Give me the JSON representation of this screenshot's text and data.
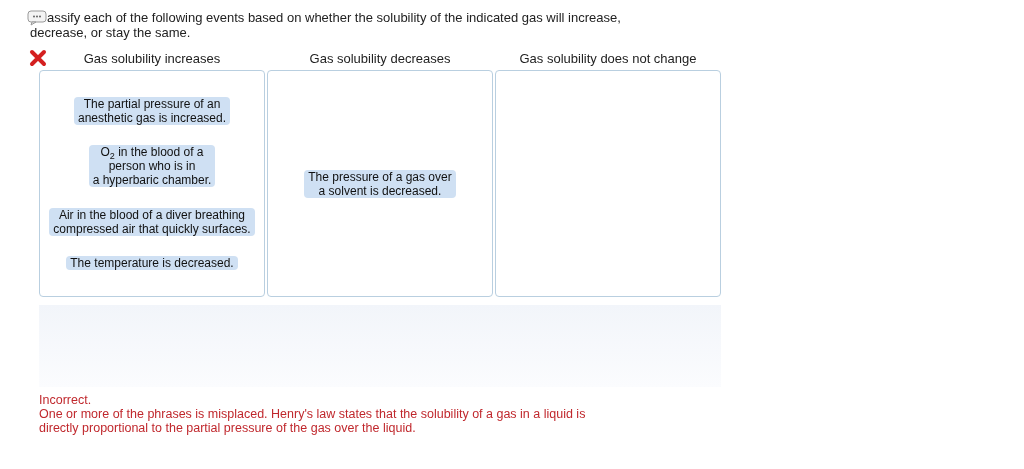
{
  "prompt_lines": [
    "assify each of the following events based on whether the solubility of the indicated gas will increase,",
    "decrease, or stay the same."
  ],
  "result": {
    "correct": false
  },
  "columns": [
    {
      "heading": "Gas solubility increases",
      "items": [
        {
          "lines": [
            "The partial pressure of an",
            "anesthetic gas is increased."
          ]
        },
        {
          "lines": [
            "O$_{2}$ in the blood of a",
            "person who is in",
            "a hyperbaric chamber."
          ]
        },
        {
          "lines": [
            "Air in the blood of a diver breathing",
            "compressed air that quickly surfaces."
          ]
        },
        {
          "lines": [
            "The temperature is decreased."
          ]
        }
      ]
    },
    {
      "heading": "Gas solubility decreases",
      "items": [
        {
          "lines": [
            "The pressure of a gas over",
            "a solvent is decreased."
          ]
        }
      ]
    },
    {
      "heading": "Gas solubility does not change"
    }
  ],
  "feedback": {
    "title": "Incorrect.",
    "lines": [
      "One or more of the phrases is misplaced. Henry's law states that the solubility of a gas in a liquid is",
      "directly proportional to the partial pressure of the gas over the liquid."
    ]
  }
}
